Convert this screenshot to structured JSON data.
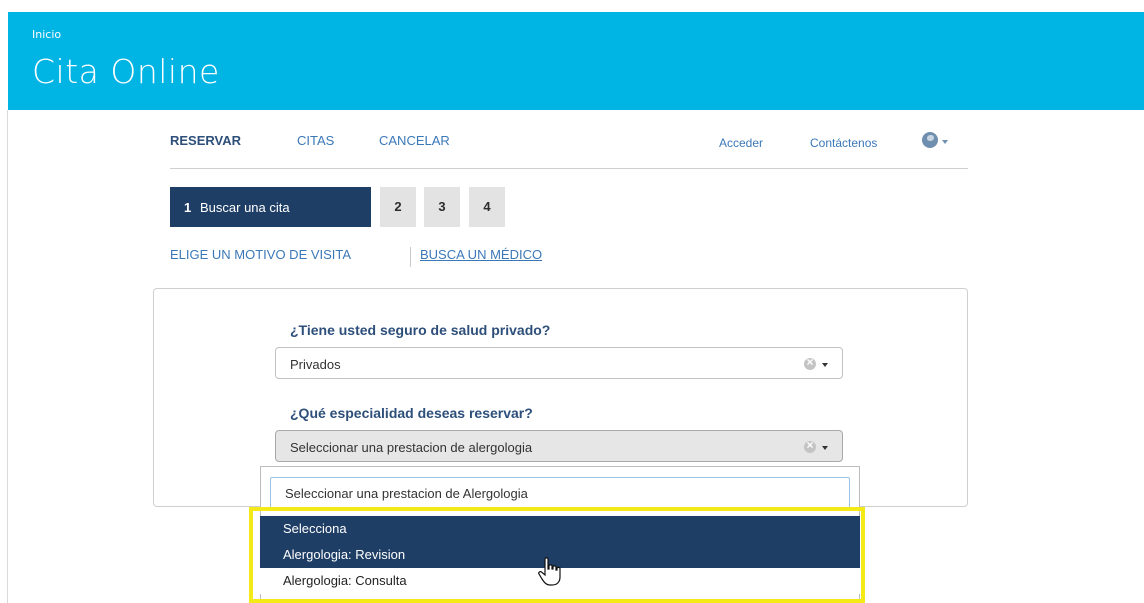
{
  "header": {
    "breadcrumb": "Inicio",
    "title": "Cita Online",
    "background_color": "#00b4e4"
  },
  "nav": {
    "items": [
      {
        "label": "RESERVAR",
        "active": true
      },
      {
        "label": "CITAS",
        "active": false
      },
      {
        "label": "CANCELAR",
        "active": false
      }
    ],
    "right": {
      "login": "Acceder",
      "contact": "Contáctenos",
      "language_icon": "globe-icon"
    }
  },
  "steps": {
    "step1": {
      "number": "1",
      "label": "Buscar una cita"
    },
    "others": [
      "2",
      "3",
      "4"
    ],
    "active_color": "#1f3e66"
  },
  "subtabs": {
    "reason": "ELIGE UN MOTIVO DE VISITA",
    "doctor": "BUSCA UN MÉDICO"
  },
  "form": {
    "insurance": {
      "question": "¿Tiene usted seguro de salud privado?",
      "value": "Privados"
    },
    "specialty": {
      "question": "¿Qué especialidad deseas reservar?",
      "value": "Seleccionar una prestacion de alergologia"
    }
  },
  "dropdown": {
    "search_value": "Seleccionar una prestacion de Alergologia",
    "options": [
      {
        "label": "Selecciona",
        "selected": true
      },
      {
        "label": "Alergologia: Revision",
        "selected": true
      },
      {
        "label": "Alergologia: Consulta",
        "selected": false
      }
    ],
    "highlight_color": "#f4ea18"
  }
}
